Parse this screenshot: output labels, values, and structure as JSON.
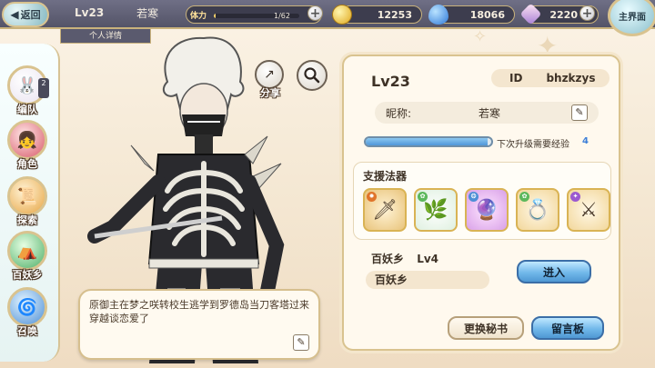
{
  "topbar": {
    "back_label": "返回",
    "level": "Lv23",
    "name": "若寒",
    "detail_tab": "个人详情",
    "stamina_label": "体力",
    "stamina_value": "1/62",
    "stamina_fraction": 0.02,
    "gold": "12253",
    "water": "18066",
    "crystal": "2220",
    "main_menu_label": "主界面"
  },
  "leftnav": {
    "items": [
      {
        "label": "编队",
        "badge": "2",
        "icon": "team-icon"
      },
      {
        "label": "角色",
        "icon": "character-icon"
      },
      {
        "label": "探索",
        "icon": "explore-icon"
      },
      {
        "label": "百妖乡",
        "icon": "village-icon"
      },
      {
        "label": "召唤",
        "icon": "summon-icon"
      }
    ]
  },
  "character": {
    "share_label": "分享",
    "bubble_text": "原御主在梦之咲转校生逃学到罗德岛当刀客塔过来穿越谈恋爱了"
  },
  "panel": {
    "level": "Lv23",
    "id_label": "ID",
    "id_value": "bhzkzys",
    "nickname_label": "昵称:",
    "nickname_value": "若寒",
    "exp_label": "下次升级需要经验",
    "exp_value": "4",
    "exp_fraction": 0.97,
    "support_title": "支援法器",
    "support_items": [
      {
        "icon": "sword-icon",
        "element": "fire"
      },
      {
        "icon": "plant-icon",
        "element": "wind"
      },
      {
        "icon": "orb-icon",
        "element": "water"
      },
      {
        "icon": "ring-icon",
        "element": "wind"
      },
      {
        "icon": "blade-icon",
        "element": "thunder"
      }
    ],
    "village_name": "百妖乡",
    "village_level": "Lv4",
    "village_display": "百妖乡",
    "enter_label": "进入",
    "change_secretary_label": "更换秘书",
    "message_board_label": "留言板"
  },
  "colors": {
    "accent_gold": "#d9c38f",
    "button_blue": "#71b8ea",
    "exp_blue": "#4f97d8"
  }
}
